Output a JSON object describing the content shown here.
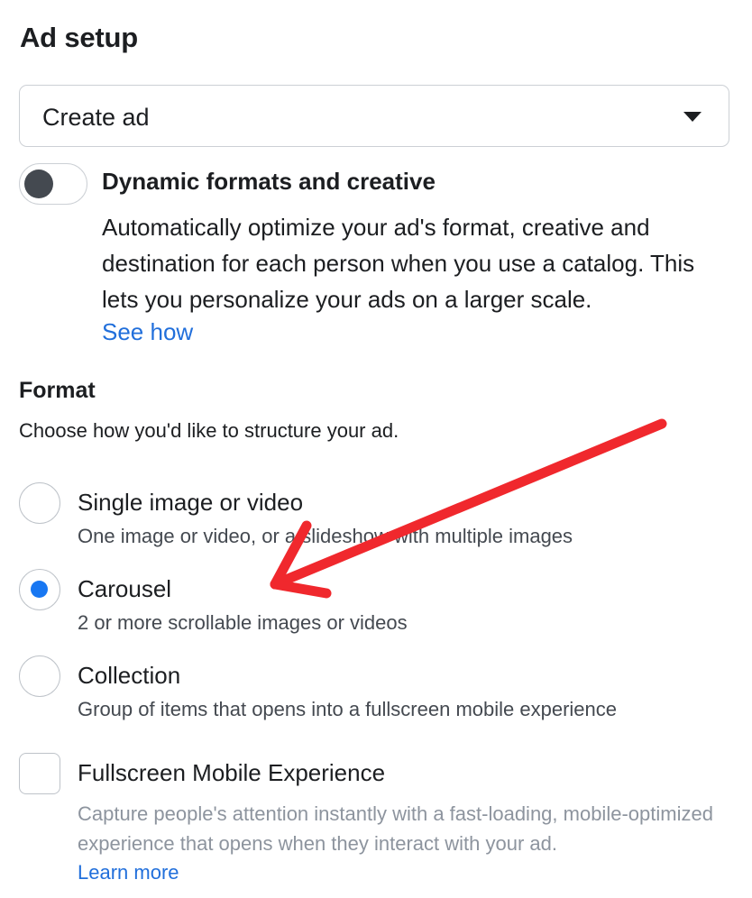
{
  "ad_setup": {
    "title": "Ad setup",
    "select": {
      "value": "Create ad",
      "caret_icon": "caret-down-icon"
    },
    "dynamic": {
      "toggle_on": false,
      "title": "Dynamic formats and creative",
      "description": "Automatically optimize your ad's format, creative and destination for each person when you use a catalog. This lets you personalize your ads on a larger scale.",
      "link": "See how"
    }
  },
  "format": {
    "title": "Format",
    "subtitle": "Choose how you'd like to structure your ad.",
    "options": [
      {
        "label": "Single image or video",
        "description": "One image or video, or a slideshow with multiple images",
        "selected": false
      },
      {
        "label": "Carousel",
        "description": "2 or more scrollable images or videos",
        "selected": true
      },
      {
        "label": "Collection",
        "description": "Group of items that opens into a fullscreen mobile experience",
        "selected": false
      }
    ],
    "fullscreen": {
      "label": "Fullscreen Mobile Experience",
      "description": "Capture people's attention instantly with a fast-loading, mobile-optimized experience that opens when they interact with your ad.",
      "link": "Learn more",
      "checked": false
    }
  },
  "colors": {
    "accent": "#1877f2",
    "link": "#216fdb",
    "annotation_arrow": "#f0282d"
  }
}
